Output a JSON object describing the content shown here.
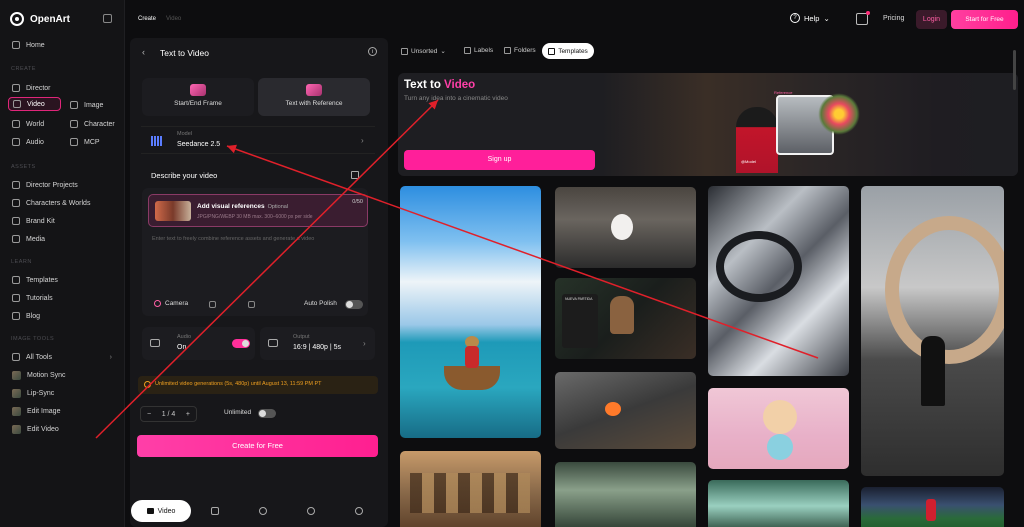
{
  "app": {
    "name": "OpenArt"
  },
  "topbar": {
    "breadcrumb": [
      "Create",
      "Video"
    ],
    "help_label": "Help",
    "pricing_label": "Pricing",
    "login_label": "Login",
    "start_label": "Start for Free"
  },
  "sidebar": {
    "home": "Home",
    "create_section": "CREATE",
    "create_items": [
      {
        "label": "Director"
      },
      {
        "label": "Video"
      },
      {
        "label": "Image"
      },
      {
        "label": "World"
      },
      {
        "label": "Character"
      },
      {
        "label": "Audio"
      },
      {
        "label": "MCP"
      }
    ],
    "assets_section": "ASSETS",
    "assets_items": [
      "Director Projects",
      "Characters & Worlds",
      "Brand Kit",
      "Media"
    ],
    "learn_section": "LEARN",
    "learn_items": [
      "Templates",
      "Tutorials",
      "Blog"
    ],
    "tools_section": "IMAGE TOOLS",
    "tools_items": [
      "All Tools",
      "Motion Sync",
      "Lip-Sync",
      "Edit Image",
      "Edit Video"
    ]
  },
  "panel": {
    "title": "Text to Video",
    "modes": [
      "Start/End Frame",
      "Text with Reference"
    ],
    "model_label": "Model",
    "model_value": "Seedance 2.5",
    "describe_title": "Describe your video",
    "ref_title": "Add visual references",
    "ref_optional": "Optional",
    "ref_sub": "JPG/PNG/WEBP 30 MB  max. 300–6000 px per side",
    "ref_count": "0/50",
    "prompt_placeholder": "Enter text to freely combine reference assets and generate a video",
    "camera_label": "Camera",
    "auto_polish_label": "Auto Polish",
    "audio_label": "Audio",
    "audio_value": "On",
    "output_label": "Output",
    "output_value": "16:9 | 480p | 5s",
    "banner": "Unlimited video generations (5s, 480p) until August 13, 11:59 PM PT",
    "stepper_value": "1 / 4",
    "unlimited_label": "Unlimited",
    "create_label": "Create for Free",
    "bottom_tab_video": "Video"
  },
  "gallery": {
    "toolbar": {
      "unsorted": "Unsorted",
      "labels": "Labels",
      "folders": "Folders",
      "templates": "Templates"
    },
    "hero": {
      "title_part1": "Text to ",
      "title_accent": "Video",
      "subtitle": "Turn any idea into a cinematic video",
      "signup": "Sign up",
      "thumb_tag": "Reference",
      "person_tag": "@Model"
    },
    "tile_overlay": {
      "title": "NUEVA PARTIDA"
    }
  },
  "colors": {
    "accent": "#ff1f9a",
    "background": "#0d0d0f",
    "panel": "#17171a",
    "annotation_arrow": "#e0202a"
  }
}
